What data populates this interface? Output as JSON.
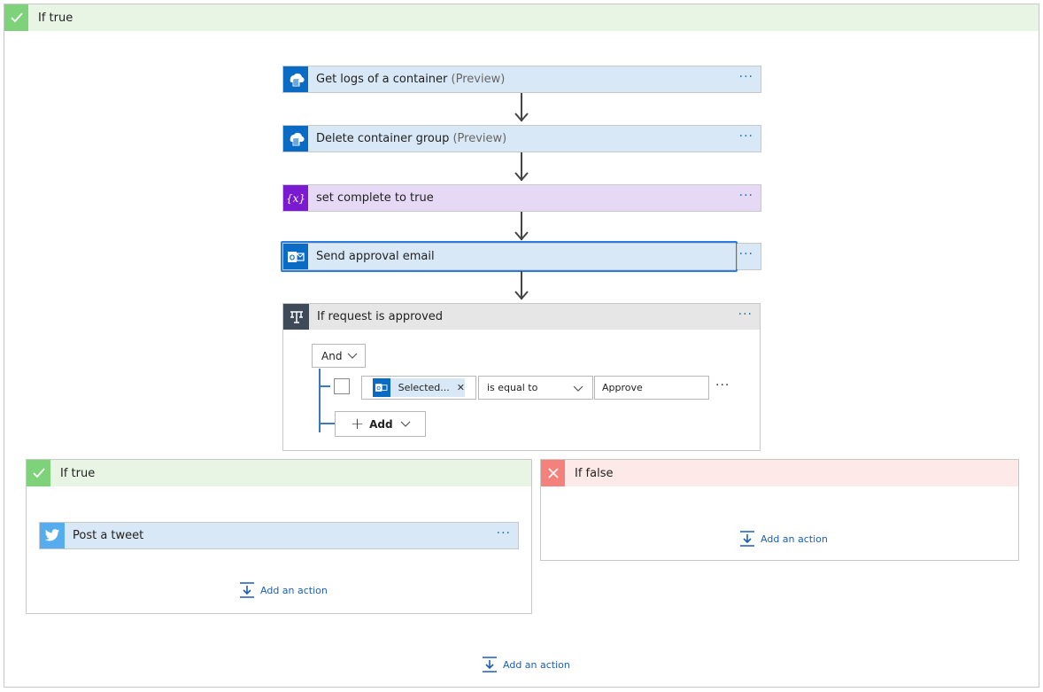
{
  "outer_scope": {
    "title": "If true"
  },
  "actions": [
    {
      "title": "Get logs of a container",
      "suffix": "(Preview)",
      "icon": "container-instance-icon",
      "color": "#0078d4"
    },
    {
      "title": "Delete container group",
      "suffix": "(Preview)",
      "icon": "container-instance-icon",
      "color": "#0078d4"
    },
    {
      "title": "set complete to true",
      "suffix": "",
      "icon": "variable-icon",
      "color": "#7a1bd2"
    },
    {
      "title": "Send approval email",
      "suffix": "",
      "icon": "outlook-icon",
      "color": "#0a6bc4"
    }
  ],
  "menu_dots": "···",
  "condition": {
    "title": "If request is approved",
    "group_operator": "And",
    "row": {
      "token_label": "Selected...",
      "token_remove": "✕",
      "operator": "is equal to",
      "value": "Approve"
    },
    "add_label": "Add",
    "add_plus": "+"
  },
  "branch_true": {
    "title": "If true",
    "action": {
      "title": "Post a tweet",
      "icon": "twitter-icon",
      "color": "#55acee"
    },
    "add_action": "Add an action"
  },
  "branch_false": {
    "title": "If false",
    "add_action": "Add an action"
  },
  "outer_add_action": "Add an action",
  "colors": {
    "accent": "#1a5fb4",
    "true_header": "#e8f5e5",
    "false_header": "#fde9e7",
    "selected_border": "#2b7de1"
  }
}
